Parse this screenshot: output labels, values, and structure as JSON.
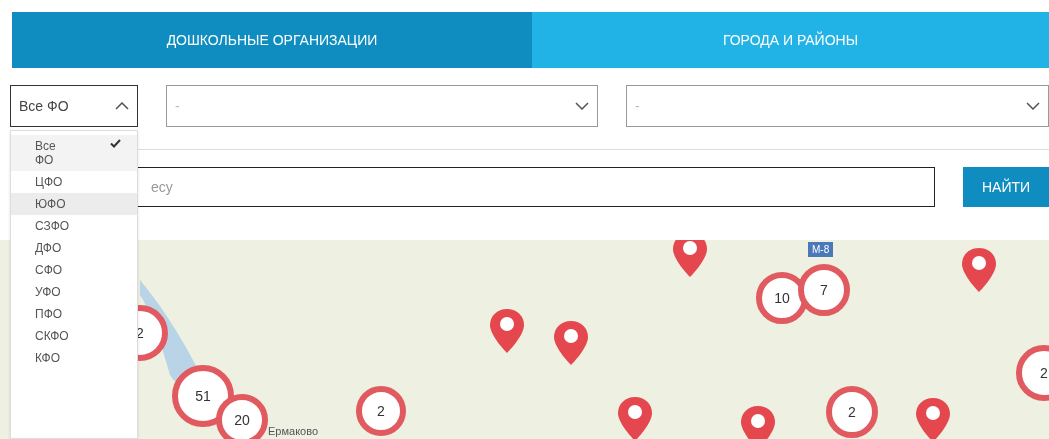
{
  "tabs": [
    {
      "label": "ДОШКОЛЬНЫЕ ОРГАНИЗАЦИИ",
      "selected": true
    },
    {
      "label": "ГОРОДА И РАЙОНЫ",
      "selected": false
    }
  ],
  "filters": [
    {
      "value": "Все ФО",
      "expanded": true
    },
    {
      "placeholder": "-",
      "expanded": false
    },
    {
      "placeholder": "-",
      "expanded": false
    }
  ],
  "dropdown": [
    {
      "label": "Все ФО",
      "selected": true,
      "highlighted": false
    },
    {
      "label": "ЦФО",
      "selected": false,
      "highlighted": false
    },
    {
      "label": "ЮФО",
      "selected": false,
      "highlighted": true
    },
    {
      "label": "СЗФО",
      "selected": false,
      "highlighted": false
    },
    {
      "label": "ДФО",
      "selected": false,
      "highlighted": false
    },
    {
      "label": "СФО",
      "selected": false,
      "highlighted": false
    },
    {
      "label": "УФО",
      "selected": false,
      "highlighted": false
    },
    {
      "label": "ПФО",
      "selected": false,
      "highlighted": false
    },
    {
      "label": "СКФО",
      "selected": false,
      "highlighted": false
    },
    {
      "label": "КФО",
      "selected": false,
      "highlighted": false
    }
  ],
  "search": {
    "placeholder": "есу",
    "button": "НАЙТИ"
  },
  "map": {
    "labels": [
      "М-8",
      "Ермаково"
    ],
    "markers": [
      {
        "kind": "cluster",
        "count": "2"
      },
      {
        "kind": "cluster",
        "count": "51"
      },
      {
        "kind": "cluster",
        "count": "20"
      },
      {
        "kind": "cluster",
        "count": "2"
      },
      {
        "kind": "cluster",
        "count": "10"
      },
      {
        "kind": "cluster",
        "count": "7"
      },
      {
        "kind": "cluster",
        "count": "2"
      },
      {
        "kind": "cluster",
        "count": "2"
      },
      {
        "kind": "pin"
      },
      {
        "kind": "pin"
      },
      {
        "kind": "pin"
      },
      {
        "kind": "pin"
      },
      {
        "kind": "pin"
      },
      {
        "kind": "pin"
      },
      {
        "kind": "pin"
      }
    ]
  }
}
